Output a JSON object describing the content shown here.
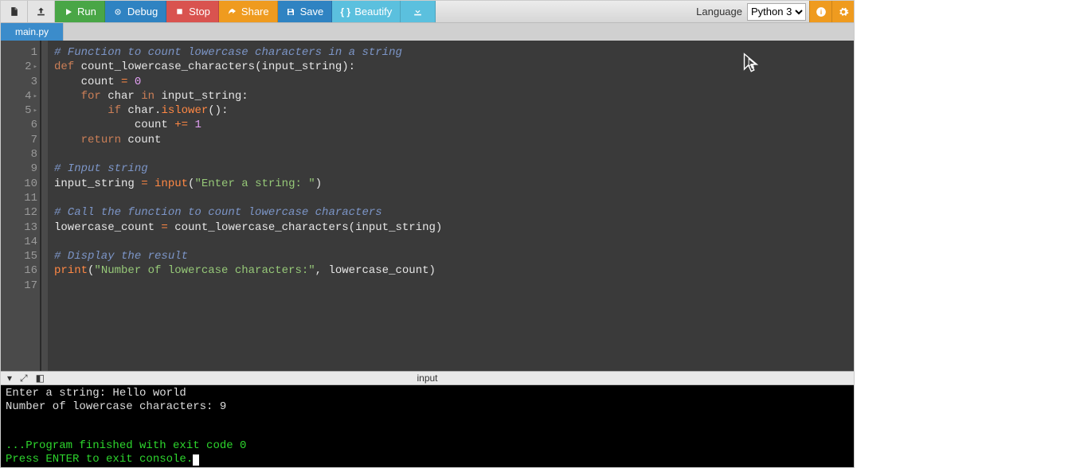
{
  "toolbar": {
    "new_label": "",
    "upload_label": "",
    "run_label": "Run",
    "debug_label": "Debug",
    "stop_label": "Stop",
    "share_label": "Share",
    "save_label": "Save",
    "beautify_label": "Beautify",
    "download_label": "",
    "language_label": "Language",
    "language_value": "Python 3"
  },
  "tabs": {
    "active": "main.py"
  },
  "editor": {
    "line_count": 17,
    "lines": {
      "l1_comment": "# Function to count lowercase characters in a string",
      "l2_kw_def": "def",
      "l2_name": " count_lowercase_characters",
      "l2_rest": "(input_string):",
      "l3_indent": "    count ",
      "l3_op": "=",
      "l3_sp": " ",
      "l3_num": "0",
      "l4_indent": "    ",
      "l4_for": "for",
      "l4_mid": " char ",
      "l4_in": "in",
      "l4_rest": " input_string:",
      "l5_indent": "        ",
      "l5_if": "if",
      "l5_mid": " char.",
      "l5_method": "islower",
      "l5_rest": "():",
      "l6_indent": "            count ",
      "l6_op": "+=",
      "l6_sp": " ",
      "l6_num": "1",
      "l7_indent": "    ",
      "l7_return": "return",
      "l7_rest": " count",
      "l9_comment": "# Input string",
      "l10_a": "input_string ",
      "l10_op": "=",
      "l10_b": " ",
      "l10_input": "input",
      "l10_paren_o": "(",
      "l10_str": "\"Enter a string: \"",
      "l10_paren_c": ")",
      "l12_comment": "# Call the function to count lowercase characters",
      "l13_a": "lowercase_count ",
      "l13_op": "=",
      "l13_b": " count_lowercase_characters(input_string)",
      "l15_comment": "# Display the result",
      "l16_print": "print",
      "l16_paren_o": "(",
      "l16_str": "\"Number of lowercase characters:\"",
      "l16_rest": ", lowercase_count)"
    }
  },
  "console_bar": {
    "title": "input"
  },
  "console": {
    "line1": "Enter a string: Hello world",
    "line2": "Number of lowercase characters: 9",
    "blank": "",
    "finished": "...Program finished with exit code 0",
    "press_enter": "Press ENTER to exit console."
  }
}
